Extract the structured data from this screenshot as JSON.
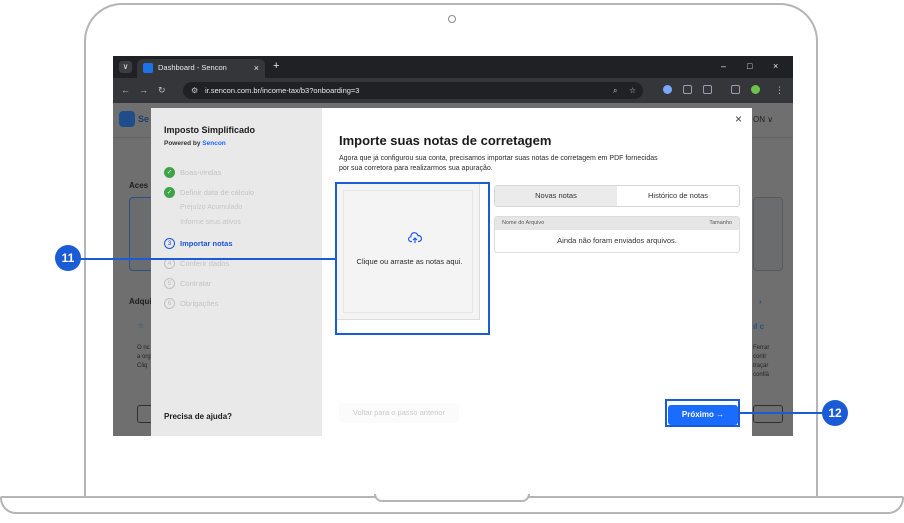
{
  "browser": {
    "tab_title": "Dashboard - Sencon",
    "tab_close": "×",
    "new_tab": "+",
    "url": "ir.sencon.com.br/income-tax/b3?onboarding=3",
    "window_minimize": "–",
    "window_maximize": "□",
    "window_close": "×"
  },
  "background": {
    "brand_partial": "Se",
    "account_partial": "ON ∨",
    "section_1_partial": "Aces",
    "section_2_partial": "Adqui",
    "left_text_lines": [
      "O nc",
      "a org",
      "Cliq"
    ],
    "right_text_lines": [
      "Ferrar",
      "contr",
      "traçar",
      "confiá"
    ],
    "right_icon_text": "ıl c"
  },
  "modal": {
    "sidebar": {
      "title": "Imposto Simplificado",
      "powered_by": "Powered by",
      "brand": "Sencon",
      "steps": [
        {
          "label": "Boas-vindas",
          "status": "done",
          "marker": "✓"
        },
        {
          "label": "Definir data de cálculo",
          "status": "done",
          "marker": "✓"
        },
        {
          "label": "Importar notas",
          "status": "active",
          "marker": "3"
        },
        {
          "label": "Conferir dados",
          "status": "todo",
          "marker": "4"
        },
        {
          "label": "Contratar",
          "status": "todo",
          "marker": "5"
        },
        {
          "label": "Obrigações",
          "status": "todo",
          "marker": "6"
        }
      ],
      "substeps": [
        "Prejuízo Acumulado",
        "Informe seus ativos"
      ],
      "help": "Precisa de ajuda?"
    },
    "close": "×",
    "title": "Importe suas notas de corretagem",
    "description": "Agora que já configurou sua conta, precisamos importar suas notas de corretagem em PDF fornecidas por sua corretora para realizarmos sua apuração.",
    "dropzone": {
      "icon": "cloud-upload-icon",
      "text": "Clique ou arraste as notas aqui."
    },
    "tabs": [
      {
        "label": "Novas notas",
        "active": true
      },
      {
        "label": "Histórico de notas",
        "active": false
      }
    ],
    "table": {
      "col_name": "Nome do Arquivo",
      "col_size": "Tamanho",
      "empty": "Ainda não foram enviados arquivos."
    },
    "back_button": "Voltar para o passo anterior",
    "next_button": "Próximo →"
  },
  "annotations": {
    "badge_upload": "11",
    "badge_next": "12",
    "color": "#1a5bd6"
  }
}
